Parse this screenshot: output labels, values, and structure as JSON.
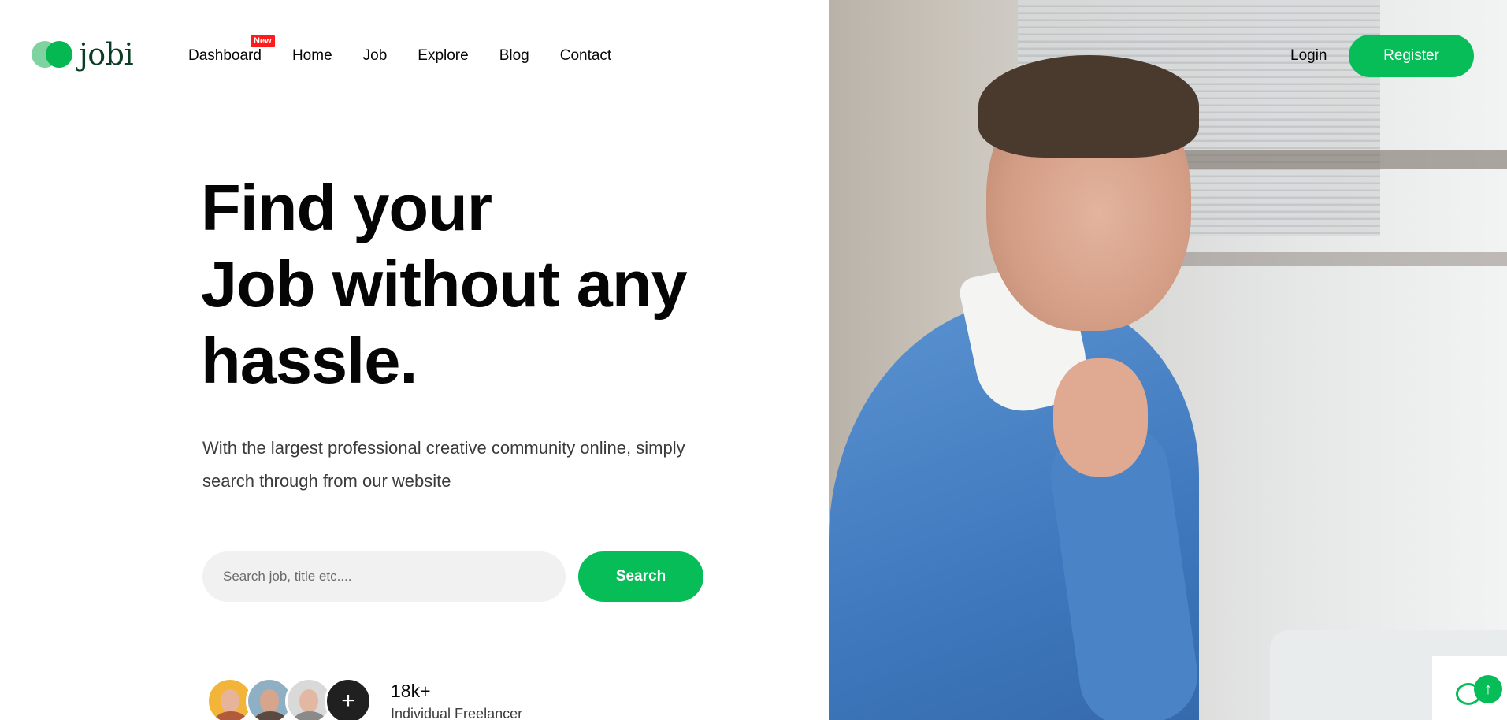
{
  "brand": {
    "name": "jobi"
  },
  "nav": {
    "items": [
      "Dashboard",
      "Home",
      "Job",
      "Explore",
      "Blog",
      "Contact"
    ],
    "badge": "New"
  },
  "auth": {
    "login": "Login",
    "register": "Register"
  },
  "hero": {
    "title_lines": [
      "Find your",
      "Job without any",
      "hassle."
    ],
    "subtitle": "With the largest professional creative community online, simply search through from our website",
    "search_placeholder": "Search job, title etc....",
    "search_button": "Search"
  },
  "stats": {
    "count": "18k+",
    "label": "Individual Freelancer",
    "more_symbol": "+"
  },
  "colors": {
    "accent": "#07bd58",
    "badge": "#ff1b1b",
    "text": "#050505"
  },
  "icons": {
    "chat": "chat-icon",
    "scroll_top": "arrow-up-icon"
  }
}
